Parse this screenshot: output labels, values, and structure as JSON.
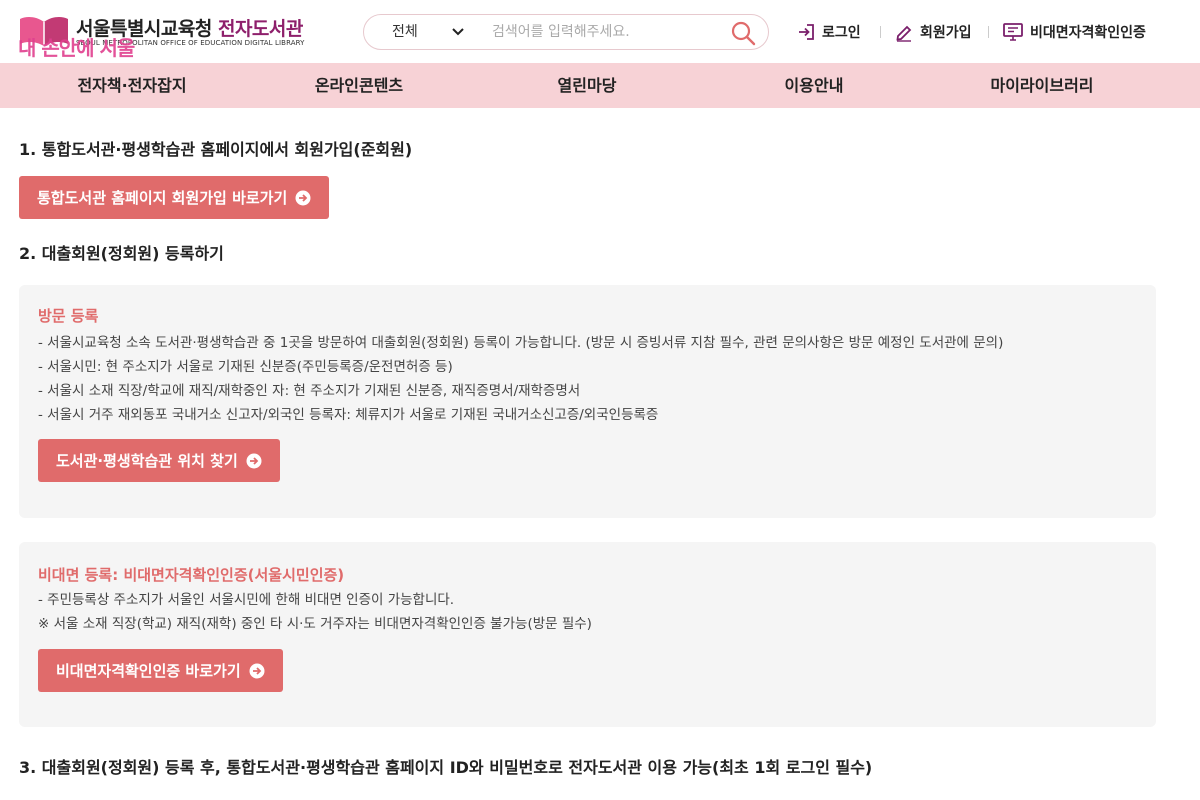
{
  "header": {
    "logo_title_main": "서울특별시교육청",
    "logo_title_accent": "전자도서관",
    "logo_sub": "SEOUL METROPOLITAN OFFICE OF EDUCATION DIGITAL LIBRARY",
    "logo_overlay": "내 손안에 서울",
    "search_scope": "전체",
    "search_placeholder": "검색어를 입력해주세요.",
    "login": "로그인",
    "signup": "회원가입",
    "verify": "비대면자격확인인증"
  },
  "nav": {
    "items": [
      "전자책·전자잡지",
      "온라인콘텐츠",
      "열린마당",
      "이용안내",
      "마이라이브러리"
    ]
  },
  "main": {
    "step1_title": "1. 통합도서관·평생학습관 홈페이지에서 회원가입(준회원)",
    "step1_button": "통합도서관 홈페이지 회원가입 바로가기",
    "step2_title": "2. 대출회원(정회원) 등록하기",
    "visit": {
      "title": "방문 등록",
      "lines": [
        "- 서울시교육청 소속 도서관·평생학습관 중 1곳을 방문하여 대출회원(정회원) 등록이 가능합니다. (방문 시 증빙서류 지참 필수, 관련 문의사항은 방문 예정인 도서관에 문의)",
        "- 서울시민: 현 주소지가 서울로 기재된 신분증(주민등록증/운전면허증 등)",
        "- 서울시 소재 직장/학교에 재직/재학중인 자: 현 주소지가 기재된 신분증, 재직증명서/재학증명서",
        "- 서울시 거주 재외동포 국내거소 신고자/외국인 등록자: 체류지가 서울로 기재된 국내거소신고증/외국인등록증"
      ],
      "button": "도서관·평생학습관 위치 찾기"
    },
    "remote": {
      "title": "비대면 등록: 비대면자격확인인증(서울시민인증)",
      "lines": [
        "- 주민등록상 주소지가 서울인 서울시민에 한해 비대면 인증이 가능합니다.",
        "※ 서울 소재 직장(학교) 재직(재학) 중인 타 시·도 거주자는 비대면자격확인인증 불가능(방문 필수)"
      ],
      "button": "비대면자격확인인증 바로가기"
    },
    "step3_title": "3. 대출회원(정회원) 등록 후, 통합도서관·평생학습관 홈페이지 ID와 비밀번호로 전자도서관 이용 가능(최초 1회 로그인 필수)"
  }
}
